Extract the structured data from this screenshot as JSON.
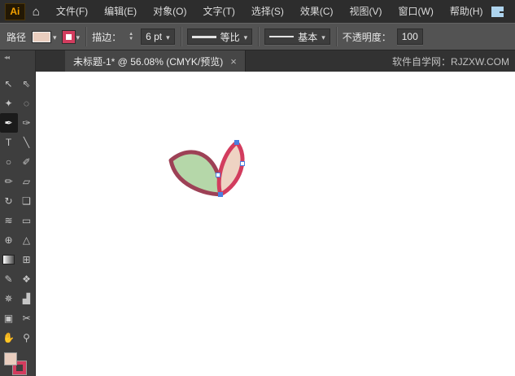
{
  "app": {
    "logo_text": "Ai"
  },
  "menubar": {
    "home_glyph": "⌂",
    "items": [
      {
        "slug": "file",
        "label": "文件(F)"
      },
      {
        "slug": "edit",
        "label": "编辑(E)"
      },
      {
        "slug": "object",
        "label": "对象(O)"
      },
      {
        "slug": "type",
        "label": "文字(T)"
      },
      {
        "slug": "select",
        "label": "选择(S)"
      },
      {
        "slug": "effect",
        "label": "效果(C)"
      },
      {
        "slug": "view",
        "label": "视图(V)"
      },
      {
        "slug": "window",
        "label": "窗口(W)"
      },
      {
        "slug": "help",
        "label": "帮助(H)"
      }
    ]
  },
  "controlbar": {
    "object_label": "路径",
    "fill_color": "#e9cdbe",
    "stroke_color": "#d23c5e",
    "stroke_label": "描边：",
    "stroke_width_value": "6 pt",
    "width_profile_label": "等比",
    "brush_label": "基本",
    "opacity_label": "不透明度：",
    "opacity_value": "100"
  },
  "tabbar": {
    "document_title": "未标题-1* @ 56.08% (CMYK/预览)",
    "close_glyph": "×",
    "watermark": "软件自学网：RJZXW.COM"
  },
  "toolbar": {
    "collapse_glyph": "◂◂",
    "tools": [
      {
        "name": "selection-tool",
        "glyph": "↖"
      },
      {
        "name": "direct-selection-tool",
        "glyph": "⇖"
      },
      {
        "name": "magic-wand-tool",
        "glyph": "✦"
      },
      {
        "name": "lasso-tool",
        "glyph": "◌"
      },
      {
        "name": "pen-tool",
        "glyph": "✒",
        "active": true
      },
      {
        "name": "curvature-tool",
        "glyph": "✑"
      },
      {
        "name": "type-tool",
        "glyph": "T"
      },
      {
        "name": "line-segment-tool",
        "glyph": "╲"
      },
      {
        "name": "ellipse-tool",
        "glyph": "○"
      },
      {
        "name": "paintbrush-tool",
        "glyph": "✐"
      },
      {
        "name": "pencil-tool",
        "glyph": "✏"
      },
      {
        "name": "eraser-tool",
        "glyph": "▱"
      },
      {
        "name": "rotate-tool",
        "glyph": "↻"
      },
      {
        "name": "scale-tool",
        "glyph": "❏"
      },
      {
        "name": "width-tool",
        "glyph": "≋"
      },
      {
        "name": "free-transform-tool",
        "glyph": "▭"
      },
      {
        "name": "shape-builder-tool",
        "glyph": "⊕"
      },
      {
        "name": "perspective-grid-tool",
        "glyph": "△"
      },
      {
        "name": "gradient-tool",
        "glyph": "",
        "gradient": true
      },
      {
        "name": "mesh-tool",
        "glyph": "⊞"
      },
      {
        "name": "eyedropper-tool",
        "glyph": "✎"
      },
      {
        "name": "blend-tool",
        "glyph": "❖"
      },
      {
        "name": "symbol-sprayer-tool",
        "glyph": "✵"
      },
      {
        "name": "column-graph-tool",
        "glyph": "▟"
      },
      {
        "name": "artboard-tool",
        "glyph": "▣"
      },
      {
        "name": "slice-tool",
        "glyph": "✂"
      },
      {
        "name": "hand-tool",
        "glyph": "✋"
      },
      {
        "name": "zoom-tool",
        "glyph": "⚲"
      }
    ]
  },
  "canvas": {
    "artwork": {
      "left_leaf": {
        "fill": "#b5d7a9",
        "stroke": "#9d4156"
      },
      "right_leaf": {
        "fill": "#eed3c3",
        "stroke": "#d23c5e"
      },
      "anchor_color": "#4a7fe0",
      "stroke_width": 5
    }
  }
}
